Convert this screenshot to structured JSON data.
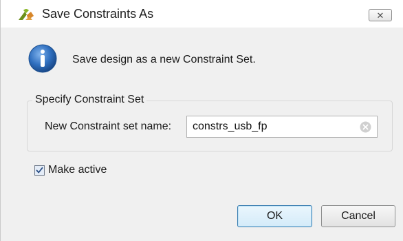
{
  "window": {
    "title": "Save Constraints As",
    "icon": "vivado-logo-icon",
    "close_icon": "close-icon"
  },
  "message": {
    "icon": "info-icon",
    "text": "Save design as a new Constraint Set."
  },
  "group": {
    "legend": "Specify Constraint Set",
    "field_label": "New Constraint set name:",
    "field_value": "constrs_usb_fp",
    "clear_icon": "clear-icon"
  },
  "make_active": {
    "label": "Make active",
    "checked": true
  },
  "buttons": {
    "ok": "OK",
    "cancel": "Cancel"
  },
  "colors": {
    "dialog_bg": "#f0f0f0",
    "info_blue": "#2f6fbf",
    "logo_green": "#6c8f1a",
    "logo_orange": "#d7862a"
  }
}
